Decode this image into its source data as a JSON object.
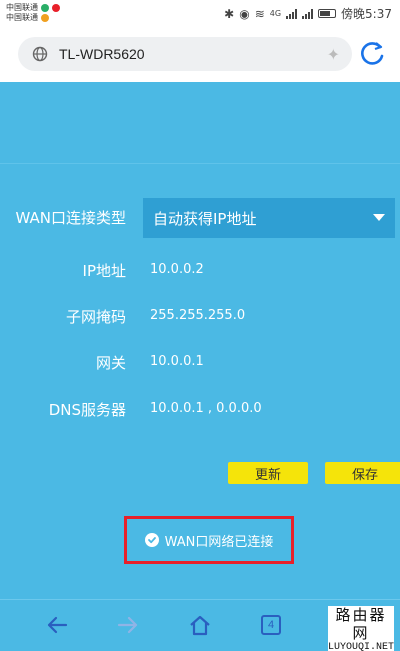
{
  "status_bar": {
    "carrier_1": "中国联通",
    "carrier_2": "中国联通",
    "network_type": "4G",
    "time_text": "傍晚5:37",
    "battery_percent_text": "60"
  },
  "browser": {
    "url": "TL-WDR5620"
  },
  "wan": {
    "connection_type_label": "WAN口连接类型",
    "connection_type_value": "自动获得IP地址",
    "ip_label": "IP地址",
    "ip_value": "10.0.0.2",
    "mask_label": "子网掩码",
    "mask_value": "255.255.255.0",
    "gateway_label": "网关",
    "gateway_value": "10.0.0.1",
    "dns_label": "DNS服务器",
    "dns_value": "10.0.0.1 , 0.0.0.0",
    "refresh_button": "更新",
    "save_button": "保存",
    "status_message": "WAN口网络已连接"
  },
  "nav": {
    "tab_count": "4"
  },
  "watermark": {
    "chinese": "路由器网",
    "domain": "LUYOUQI.NET"
  },
  "colors": {
    "background": "#4bb9e4",
    "select_background": "#2f9fd3",
    "button_yellow": "#f5e40a",
    "highlight_red": "#e8202a",
    "nav_icon_blue": "#2a5fbf"
  }
}
